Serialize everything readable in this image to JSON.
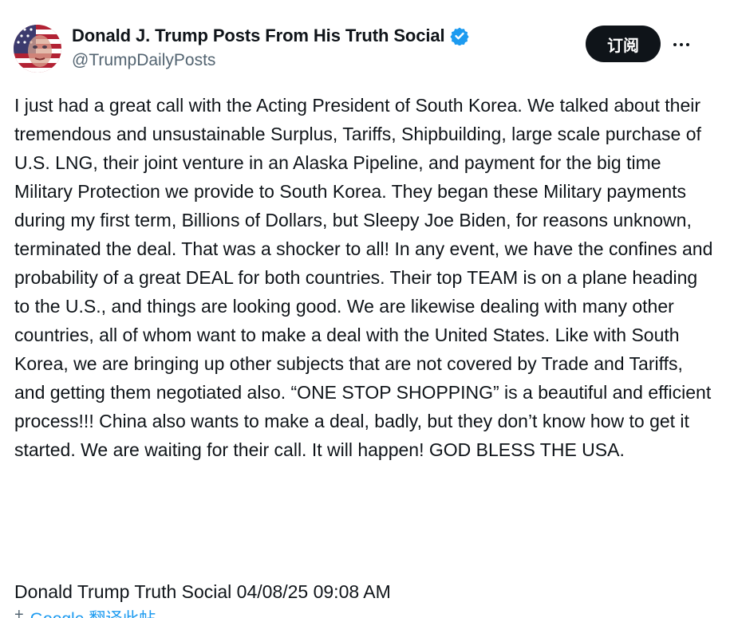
{
  "author": {
    "display_name": "Donald J. Trump Posts From His Truth Social",
    "handle": "@TrumpDailyPosts",
    "verified": true,
    "avatar_icon": "flag-face-avatar-icon",
    "verified_icon": "verified-badge-icon"
  },
  "actions": {
    "subscribe_label": "订阅",
    "more_icon": "more-options-icon"
  },
  "post": {
    "text": "I just had a great call with the Acting President of South Korea. We talked about their tremendous and unsustainable Surplus, Tariffs, Shipbuilding, large scale purchase of U.S. LNG, their joint venture in an Alaska Pipeline, and payment for the big time Military Protection we provide to South Korea. They began these Military payments during my first term, Billions of Dollars, but Sleepy Joe Biden, for reasons unknown, terminated the deal. That was a shocker to all! In any event, we have the confines and probability of a great DEAL for both countries. Their top TEAM is on a plane heading to the U.S., and things are looking good. We are likewise dealing with many other countries, all of whom want to make a deal with the United States. Like with South Korea, we are bringing up other subjects that are not covered by Trade and Tariffs, and getting them negotiated also. “ONE STOP SHOPPING” is a beautiful and efficient process!!! China also wants to make a deal, badly, but they don’t know how to get it started. We are waiting for their call. It will happen! GOD BLESS THE USA.",
    "source_line": "Donald Trump Truth Social 04/08/25 09:08 AM",
    "translate_label": "Google 翻译此帖"
  },
  "colors": {
    "text": "#0f1419",
    "secondary": "#536471",
    "verified": "#1d9bf0",
    "button_bg": "#0f1419",
    "button_text": "#ffffff"
  }
}
